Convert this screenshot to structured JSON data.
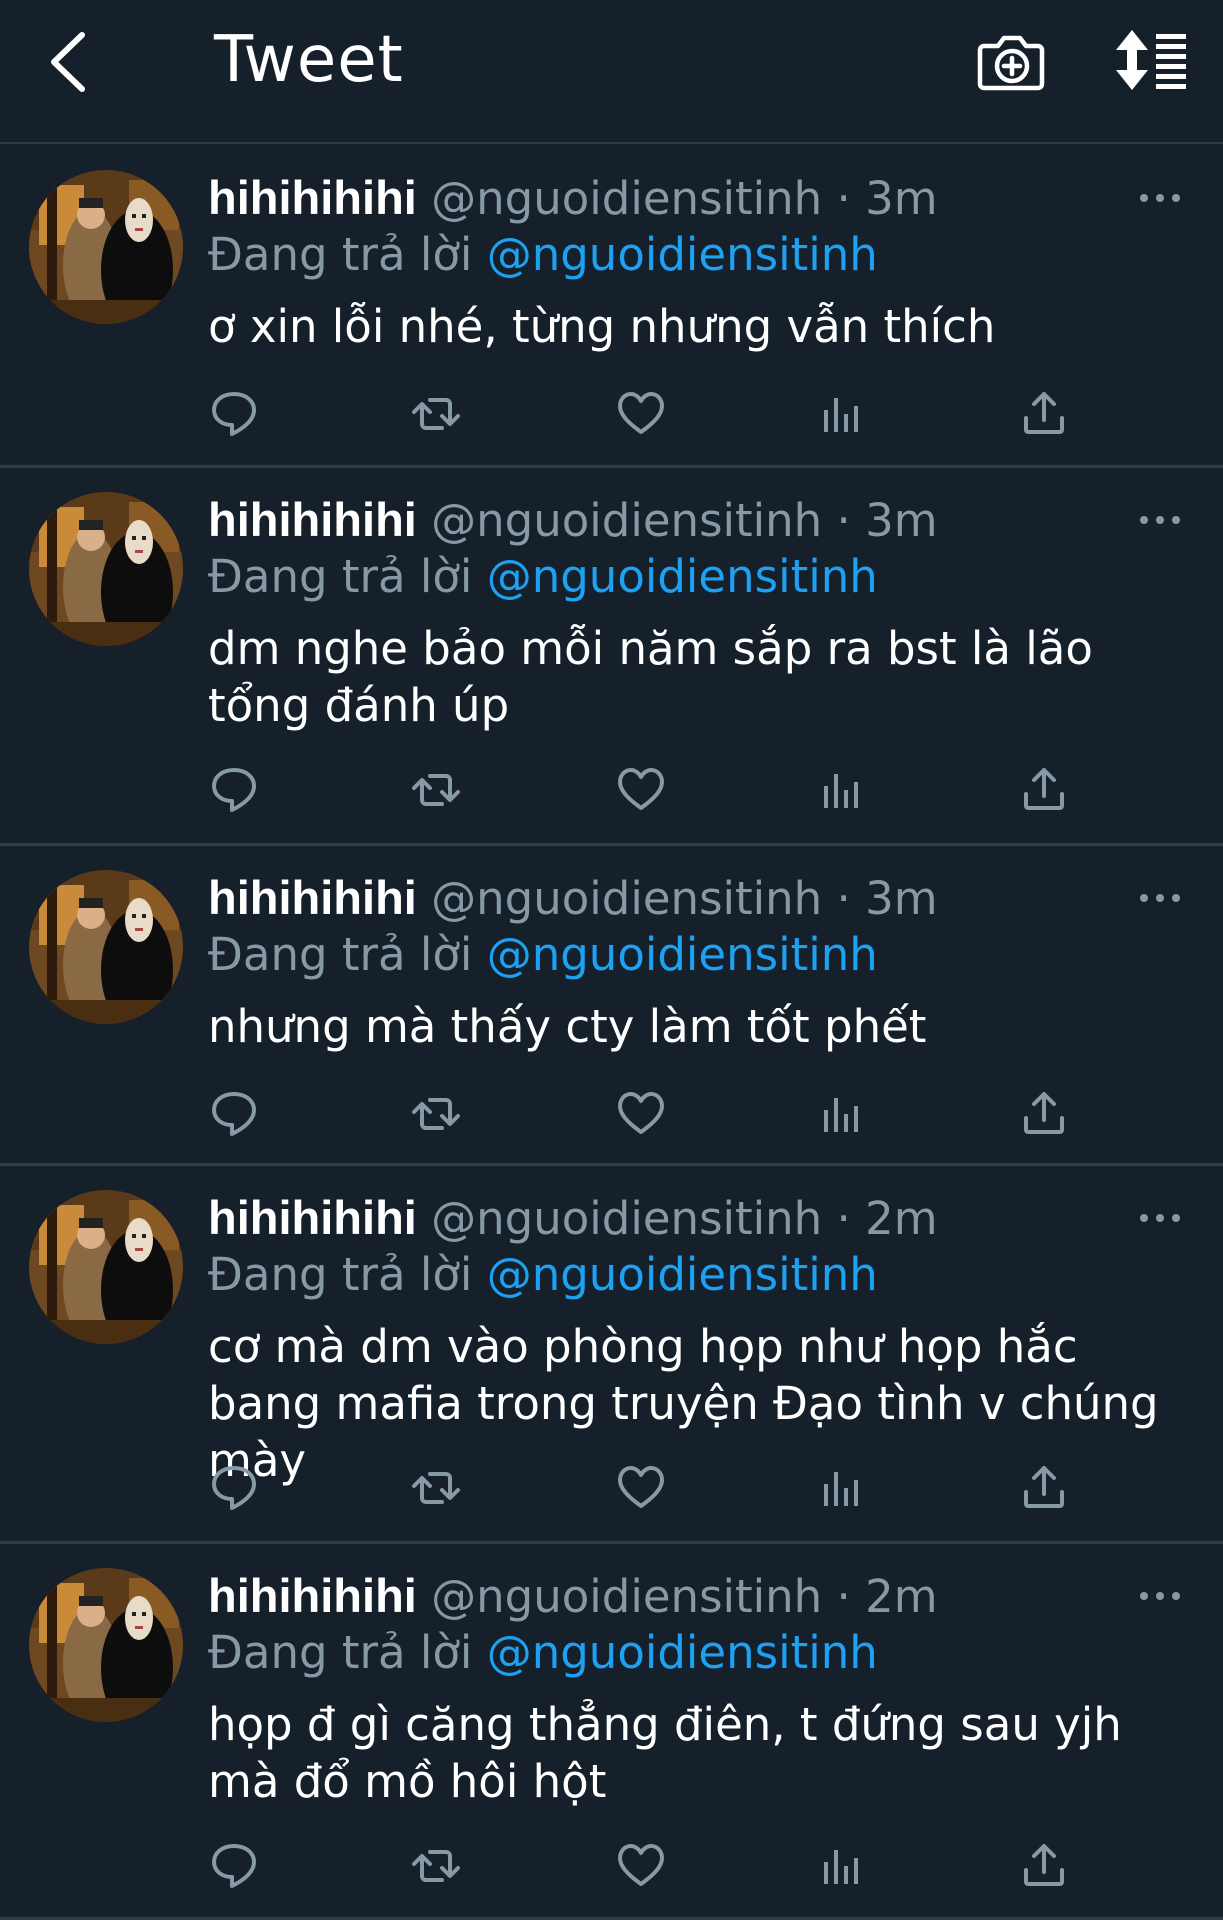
{
  "header": {
    "title": "Tweet",
    "back_icon": "chevron-left-icon",
    "camera_icon": "camera-plus-icon",
    "sort_icon": "sort-list-icon"
  },
  "colors": {
    "background": "#15202b",
    "divider": "#2f3b47",
    "secondary_text": "#8899a6",
    "accent": "#1da1f2"
  },
  "tweets": [
    {
      "display_name": "hihihihihi",
      "handle": "@nguoidiensitinh",
      "separator": "·",
      "time": "3m",
      "reply_prefix": "Đang trả lời",
      "reply_to": "@nguoidiensitinh",
      "text": "ơ xin lỗi nhé, từng nhưng vẫn thích"
    },
    {
      "display_name": "hihihihihi",
      "handle": "@nguoidiensitinh",
      "separator": "·",
      "time": "3m",
      "reply_prefix": "Đang trả lời",
      "reply_to": "@nguoidiensitinh",
      "text": "dm nghe bảo mỗi năm sắp ra bst là lão tổng đánh úp"
    },
    {
      "display_name": "hihihihihi",
      "handle": "@nguoidiensitinh",
      "separator": "·",
      "time": "3m",
      "reply_prefix": "Đang trả lời",
      "reply_to": "@nguoidiensitinh",
      "text": "nhưng mà thấy cty làm tốt phết"
    },
    {
      "display_name": "hihihihihi",
      "handle": "@nguoidiensitinh",
      "separator": "·",
      "time": "2m",
      "reply_prefix": "Đang trả lời",
      "reply_to": "@nguoidiensitinh",
      "text": "cơ mà dm vào phòng họp như họp hắc bang mafia trong truyện Đạo tình v chúng mày"
    },
    {
      "display_name": "hihihihihi",
      "handle": "@nguoidiensitinh",
      "separator": "·",
      "time": "2m",
      "reply_prefix": "Đang trả lời",
      "reply_to": "@nguoidiensitinh",
      "text": "họp đ gì căng thẳng điên, t đứng sau yjh mà đổ mồ hôi hột"
    }
  ],
  "action_icons": [
    "reply-icon",
    "retweet-icon",
    "like-icon",
    "analytics-icon",
    "share-icon"
  ]
}
